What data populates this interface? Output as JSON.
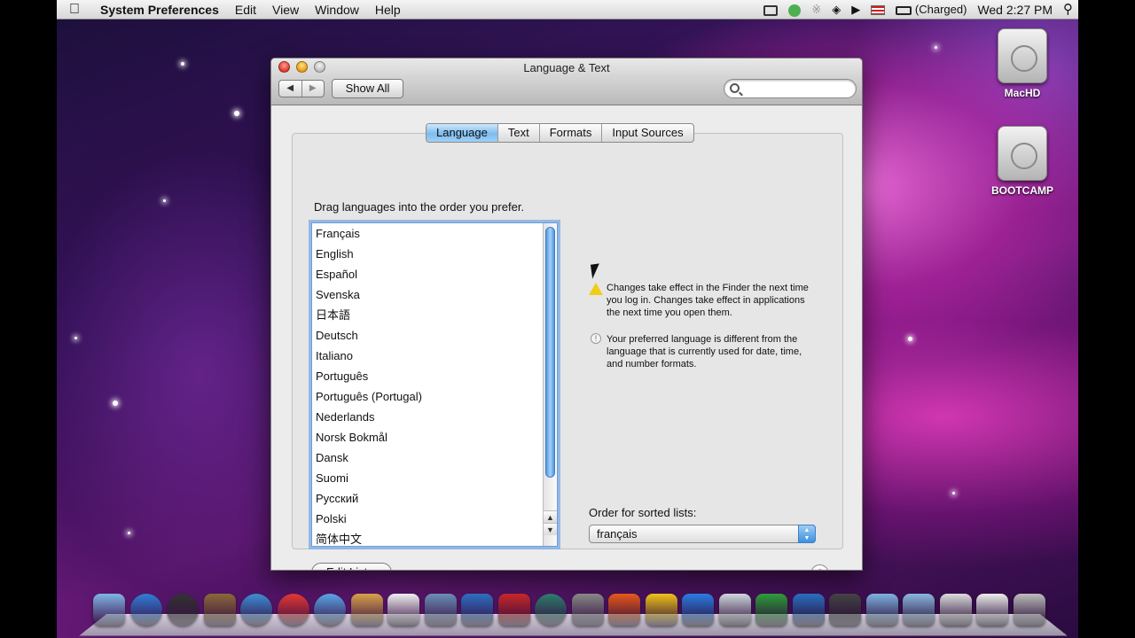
{
  "menubar": {
    "app_name": "System Preferences",
    "menus": [
      "Edit",
      "View",
      "Window",
      "Help"
    ],
    "battery_status": "(Charged)",
    "clock": "Wed 2:27 PM"
  },
  "desktop": {
    "icons": [
      "MacHD",
      "BOOTCAMP"
    ]
  },
  "window": {
    "title": "Language & Text",
    "show_all": "Show All",
    "search_placeholder": "",
    "tabs": [
      {
        "label": "Language",
        "selected": true
      },
      {
        "label": "Text",
        "selected": false
      },
      {
        "label": "Formats",
        "selected": false
      },
      {
        "label": "Input Sources",
        "selected": false
      }
    ],
    "instructions": "Drag languages into the order you prefer.",
    "languages": [
      "Français",
      "English",
      "Español",
      "Svenska",
      "日本語",
      "Deutsch",
      "Italiano",
      "Português",
      "Português (Portugal)",
      "Nederlands",
      "Norsk Bokmål",
      "Dansk",
      "Suomi",
      "Русский",
      "Polski",
      "简体中文"
    ],
    "notes": {
      "warning": "Changes take effect in the Finder the next time you log in. Changes take effect in applications the next time you open them.",
      "info": "Your preferred language is different from the language that is currently used for date, time, and number formats."
    },
    "sorted_lists_label": "Order for sorted lists:",
    "sorted_lists_value": "français",
    "edit_list": "Edit List...",
    "help": "?"
  },
  "dock": {
    "apps": [
      "finder",
      "app-store",
      "dashboard",
      "preview",
      "safari",
      "chrome",
      "ichat",
      "address-book",
      "ical",
      "iphoto",
      "itunes",
      "photo-booth",
      "time-machine",
      "system-preferences",
      "powerpoint",
      "outlook",
      "word",
      "network-utility",
      "excel",
      "quicktime",
      "imovie",
      "applications-folder",
      "documents-folder",
      "downloads-stack",
      "document-stack",
      "trash"
    ]
  },
  "colors": {
    "accent": "#7cbcef",
    "warning": "#f2cc1b",
    "help_mark": "#7a2aa0"
  }
}
